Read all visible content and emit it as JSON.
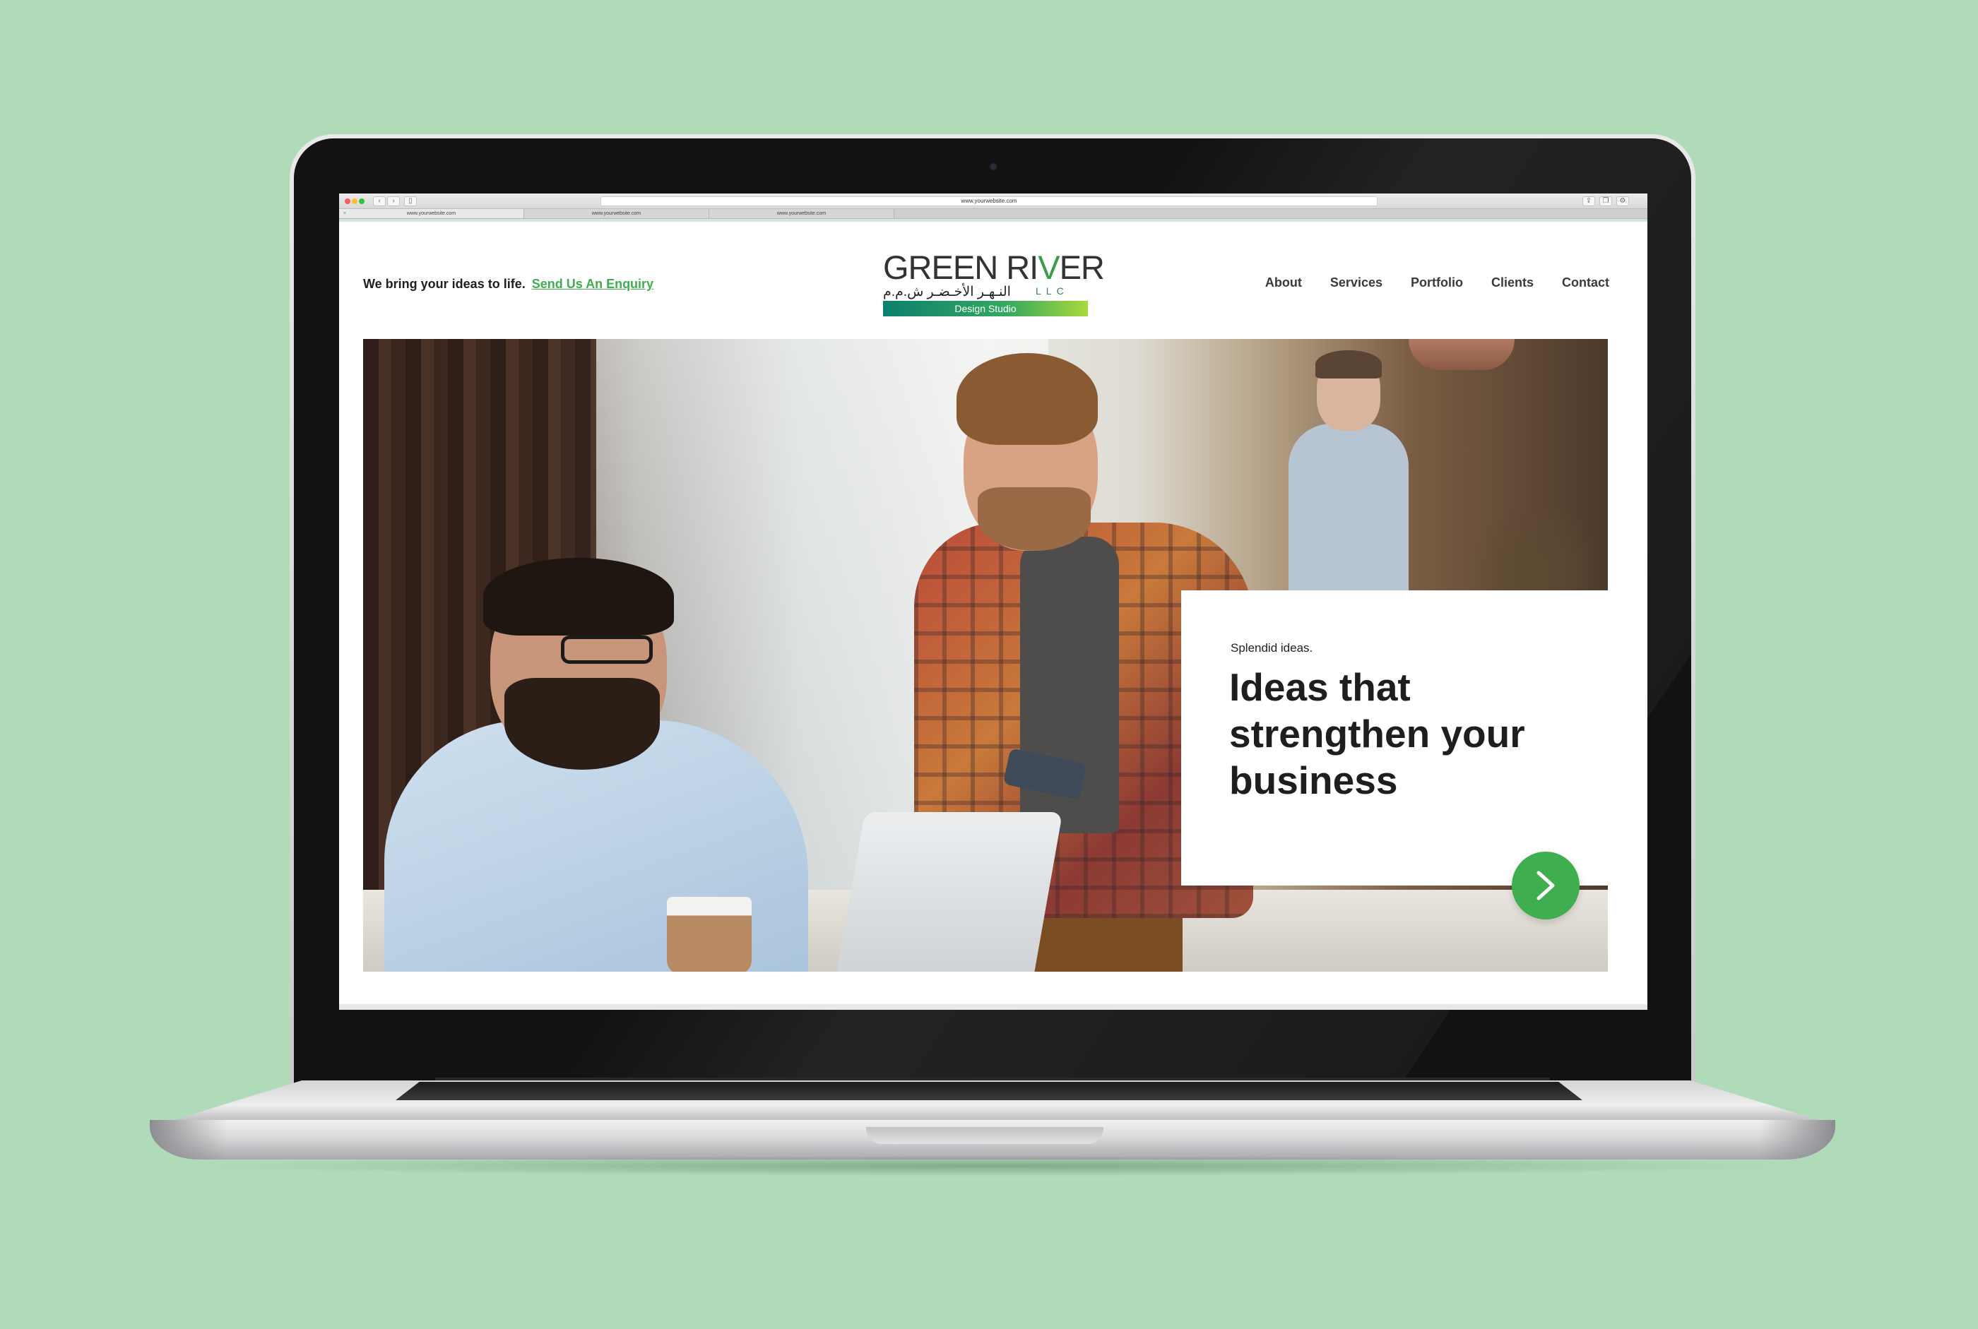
{
  "browser": {
    "url": "www.yourwebsite.com",
    "tabs": [
      {
        "label": "www.yourwebsite.com",
        "active": true
      },
      {
        "label": "www.yourwebsite.com",
        "active": false
      },
      {
        "label": "www.yourwebsite.com",
        "active": false
      }
    ],
    "tab_close": "×",
    "toolbar_icons": [
      "back-icon",
      "forward-icon",
      "sidebar-icon",
      "reader-icon",
      "reload-icon",
      "share-icon",
      "tabs-icon",
      "settings-icon"
    ]
  },
  "header": {
    "tagline": "We bring your ideas to life.",
    "enquiry_link": "Send Us An Enquiry",
    "logo": {
      "text_start": "GREEN RI",
      "text_v": "V",
      "text_end": "ER",
      "arabic": "النـهـر الأخـضـر ش.م.م",
      "llc": "LLC",
      "tagline": "Design Studio"
    },
    "nav": [
      "About",
      "Services",
      "Portfolio",
      "Clients",
      "Contact"
    ]
  },
  "hero": {
    "eyebrow": "Splendid ideas.",
    "title": "Ideas that strengthen your business",
    "next_button_icon": "chevron-right-icon"
  },
  "colors": {
    "background": "#b0dbb8",
    "accent_green": "#3fae4f",
    "logo_gradient_start": "#0d7f6f",
    "logo_gradient_end": "#a9d83c"
  }
}
